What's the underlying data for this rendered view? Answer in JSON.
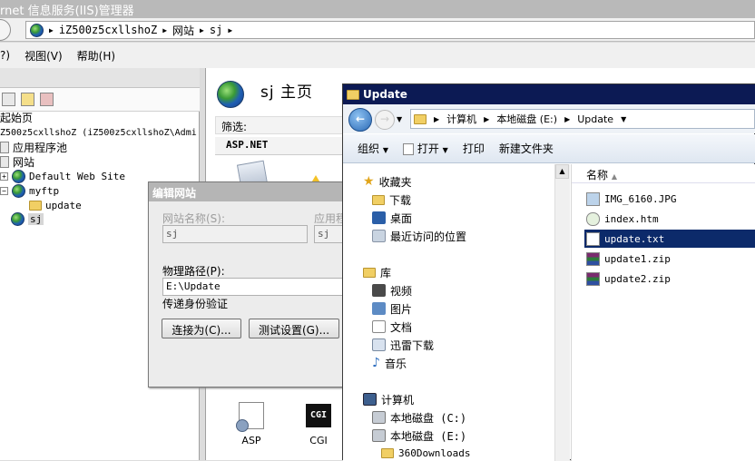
{
  "iis": {
    "title": "rnet 信息服务(IIS)管理器",
    "breadcrumb": [
      "iZ500z5cxllshoZ",
      "网站",
      "sj"
    ],
    "menu": [
      "?)",
      "视图(V)",
      "帮助(H)"
    ],
    "tree": {
      "start_page": "起始页",
      "server": "Z500z5cxllshoZ (iZ500z5cxllshoZ\\Admi",
      "app_pools": "应用程序池",
      "sites": "网站",
      "default_site": "Default Web Site",
      "myftp": "myftp",
      "update": "update",
      "sj": "sj"
    },
    "home_title": "sj 主页",
    "filter_label": "筛选:",
    "aspnet_label": "ASP.NET",
    "features": [
      "ASP",
      "CGI"
    ],
    "cgi_icon_text": "CGI"
  },
  "edit_dialog": {
    "title": "编辑网站",
    "site_name_label": "网站名称(S):",
    "site_name_value": "sj",
    "app_pool_label": "应用程",
    "app_pool_value": "sj",
    "physical_path_label": "物理路径(P):",
    "physical_path_value": "E:\\Update",
    "auth_label": "传递身份验证",
    "connect_as_button": "连接为(C)...",
    "test_settings_button": "测试设置(G)..."
  },
  "explorer": {
    "title": "Update",
    "address": [
      "计算机",
      "本地磁盘 (E:)",
      "Update"
    ],
    "commands": [
      "组织",
      "打开",
      "打印",
      "新建文件夹"
    ],
    "nav": {
      "favorites": "收藏夹",
      "downloads": "下载",
      "desktop": "桌面",
      "recent": "最近访问的位置",
      "libraries": "库",
      "videos": "视频",
      "pictures": "图片",
      "documents": "文档",
      "thunder": "迅雷下载",
      "music": "音乐",
      "computer": "计算机",
      "drive_c": "本地磁盘 (C:)",
      "drive_e": "本地磁盘 (E:)",
      "folder_360": "360Downloads"
    },
    "column_name": "名称",
    "files": [
      {
        "name": "IMG_6160.JPG",
        "icon": "image-file-icon"
      },
      {
        "name": "index.htm",
        "icon": "html-file-icon"
      },
      {
        "name": "update.txt",
        "icon": "text-file-icon",
        "selected": true
      },
      {
        "name": "update1.zip",
        "icon": "zip-file-icon"
      },
      {
        "name": "update2.zip",
        "icon": "zip-file-icon"
      }
    ]
  },
  "colors": {
    "explorer_title_bg": "#0c1a54",
    "selection_bg": "#0c2a6a",
    "iis_title_bg": "#b9b9b9"
  }
}
